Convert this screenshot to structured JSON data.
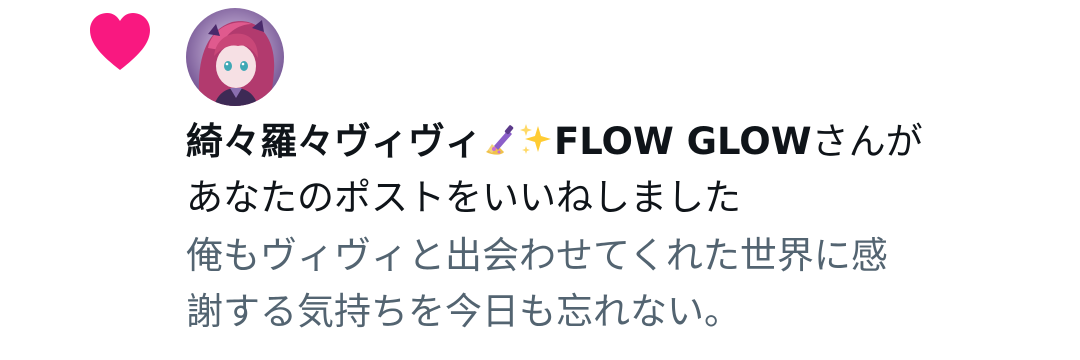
{
  "notification": {
    "type_icon": "heart-icon",
    "accent_color": "#f91880",
    "avatar_icon": "user-avatar",
    "user_name": "綺々羅々ヴィヴィ",
    "user_name_emojis": [
      "nail-polish-emoji",
      "sparkles-emoji"
    ],
    "user_name_suffix": "FLOW GLOW",
    "action_suffix": "さんが",
    "action_line2": "あなたのポストをいいねしました",
    "post_text_line1": "俺もヴィヴィと出会わせてくれた世界に感",
    "post_text_line2": "謝する気持ちを今日も忘れない。"
  }
}
